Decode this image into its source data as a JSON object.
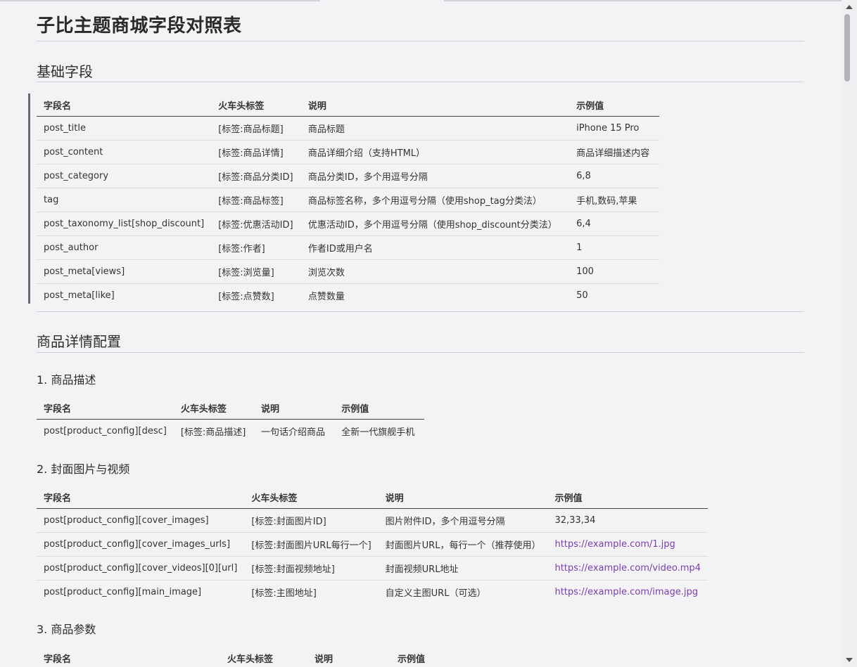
{
  "page_title": "子比主题商城字段对照表",
  "sections": {
    "basic": {
      "title": "基础字段",
      "headers": [
        "字段名",
        "火车头标签",
        "说明",
        "示例值"
      ],
      "rows": [
        [
          "post_title",
          "[标签:商品标题]",
          "商品标题",
          "iPhone 15 Pro"
        ],
        [
          "post_content",
          "[标签:商品详情]",
          "商品详细介绍（支持HTML）",
          "商品详细描述内容"
        ],
        [
          "post_category",
          "[标签:商品分类ID]",
          "商品分类ID，多个用逗号分隔",
          "6,8"
        ],
        [
          "tag",
          "[标签:商品标签]",
          "商品标签名称，多个用逗号分隔（使用shop_tag分类法）",
          "手机,数码,苹果"
        ],
        [
          "post_taxonomy_list[shop_discount]",
          "[标签:优惠活动ID]",
          "优惠活动ID，多个用逗号分隔（使用shop_discount分类法）",
          "6,4"
        ],
        [
          "post_author",
          "[标签:作者]",
          "作者ID或用户名",
          "1"
        ],
        [
          "post_meta[views]",
          "[标签:浏览量]",
          "浏览次数",
          "100"
        ],
        [
          "post_meta[like]",
          "[标签:点赞数]",
          "点赞数量",
          "50"
        ]
      ]
    },
    "detail": {
      "title": "商品详情配置",
      "desc": {
        "title": "1. 商品描述",
        "headers": [
          "字段名",
          "火车头标签",
          "说明",
          "示例值"
        ],
        "rows": [
          [
            "post[product_config][desc]",
            "[标签:商品描述]",
            "一句话介绍商品",
            "全新一代旗舰手机"
          ]
        ]
      },
      "cover": {
        "title": "2. 封面图片与视频",
        "headers": [
          "字段名",
          "火车头标签",
          "说明",
          "示例值"
        ],
        "rows": [
          [
            "post[product_config][cover_images]",
            "[标签:封面图片ID]",
            "图片附件ID，多个用逗号分隔",
            "32,33,34"
          ],
          [
            "post[product_config][cover_images_urls]",
            "[标签:封面图片URL每行一个]",
            "封面图片URL，每行一个（推荐使用）",
            "https://example.com/1.jpg"
          ],
          [
            "post[product_config][cover_videos][0][url]",
            "[标签:封面视频地址]",
            "封面视频URL地址",
            "https://example.com/video.mp4"
          ],
          [
            "post[product_config][main_image]",
            "[标签:主图地址]",
            "自定义主图URL（可选）",
            "https://example.com/image.jpg"
          ]
        ]
      },
      "params": {
        "title": "3. 商品参数",
        "headers": [
          "字段名",
          "火车头标签",
          "说明",
          "示例值"
        ]
      }
    }
  },
  "colors": {
    "link": "#7a3fb0",
    "background": "#f3f3f5"
  }
}
